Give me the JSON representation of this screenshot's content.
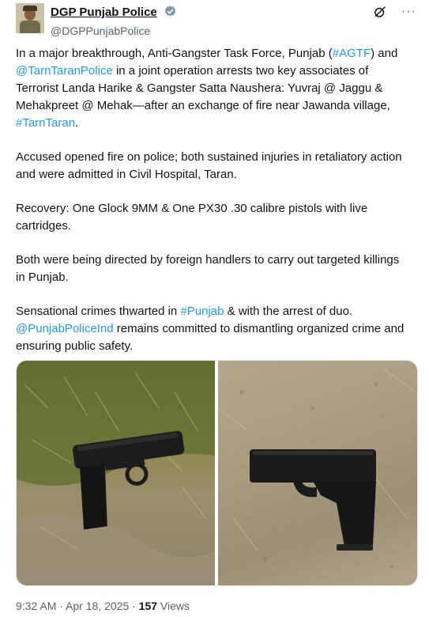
{
  "author": {
    "display_name": "DGP Punjab Police",
    "handle": "@DGPPunjabPolice"
  },
  "icons": {
    "avatar": "profile-photo",
    "verified": "verified-badge-icon",
    "grok": "grok-icon",
    "more": "more-options-icon"
  },
  "more_glyph": "···",
  "tweet": {
    "p1": {
      "t1": "In a major breakthrough, Anti-Gangster Task Force, Punjab (",
      "l1": "#AGTF",
      "t2": ")  and ",
      "l2": "@TarnTaranPolice",
      "t3": " in a joint operation arrests two key associates of Terrorist Landa Harike & Gangster Satta Naushera: Yuvraj @ Jaggu & Mehakpreet @ Mehak—after an exchange of fire near Jawanda village, ",
      "l3": "#TarnTaran",
      "t4": "."
    },
    "p2": "Accused opened fire on police; both sustained injuries in retaliatory action and were admitted in Civil Hospital, Taran.",
    "p3": "Recovery: One Glock 9MM & One PX30 .30 calibre pistols with live cartridges.",
    "p4": "Both were being directed by foreign handlers to carry out targeted killings in Punjab.",
    "p5": {
      "t1": "Sensational crimes thwarted in ",
      "l1": "#Punjab",
      "t2": " & with the arrest of duo.",
      "l2": "@PunjabPoliceInd",
      "t3": " remains committed to dismantling organized crime and ensuring public safety."
    }
  },
  "meta": {
    "time": "9:32 AM",
    "sep1": " · ",
    "date": "Apr 18, 2025",
    "sep2": " · ",
    "views_count": "157",
    "views_label": " Views"
  },
  "colors": {
    "link": "#1d9bf0",
    "text": "#0f1419",
    "secondary": "#536471",
    "verified": "#829aab"
  }
}
